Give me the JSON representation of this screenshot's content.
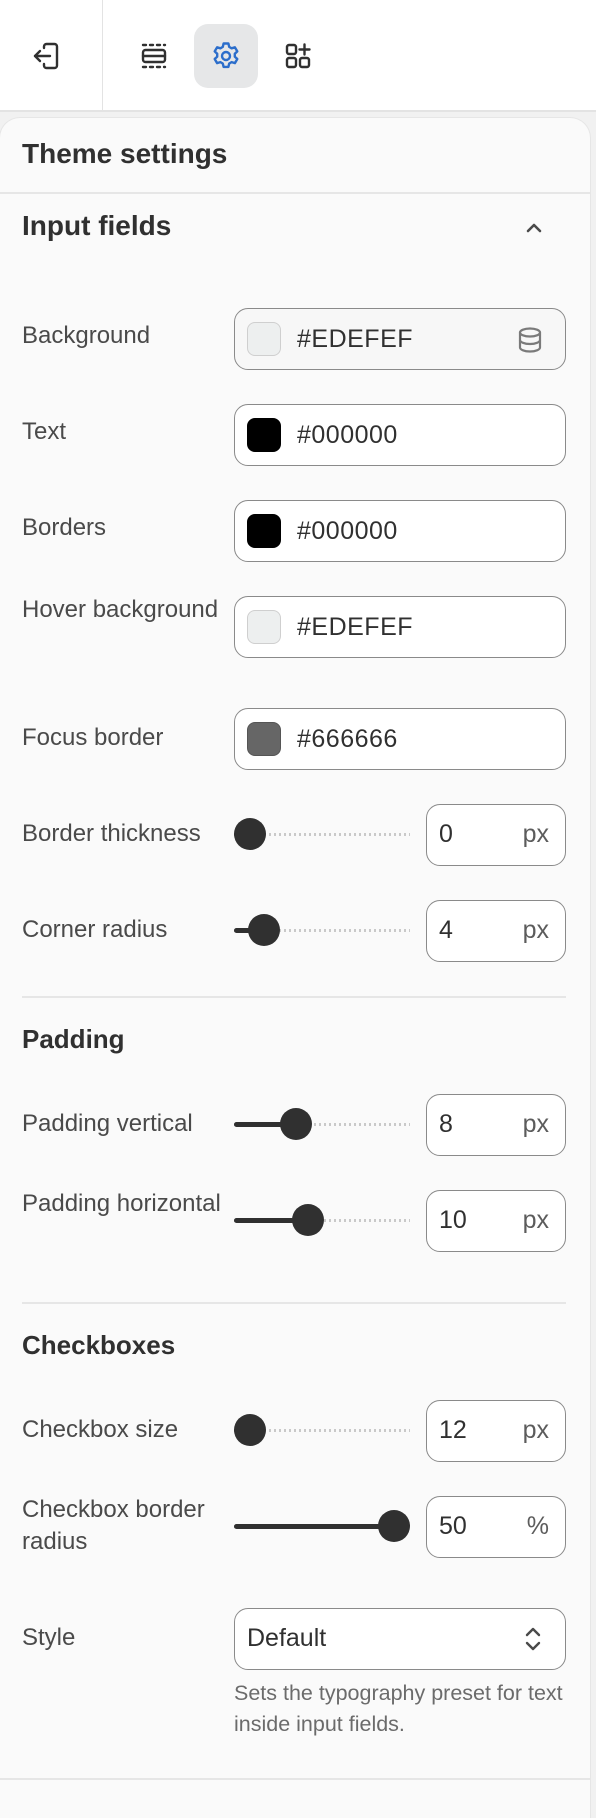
{
  "toolbar": {
    "buttons": [
      {
        "icon": "exit-icon",
        "active": false
      },
      {
        "icon": "sections-icon",
        "active": false
      },
      {
        "icon": "settings-gear-icon",
        "active": true
      },
      {
        "icon": "apps-add-icon",
        "active": false
      }
    ],
    "active_color": "#2c6ecb"
  },
  "panel": {
    "title": "Theme settings"
  },
  "input_fields": {
    "heading": "Input fields",
    "expanded": true,
    "colors": [
      {
        "label": "Background",
        "value": "#EDEFEF",
        "swatch": "#EDEFEF",
        "linked": true
      },
      {
        "label": "Text",
        "value": "#000000",
        "swatch": "#000000",
        "linked": false
      },
      {
        "label": "Borders",
        "value": "#000000",
        "swatch": "#000000",
        "linked": false
      },
      {
        "label": "Hover background",
        "value": "#EDEFEF",
        "swatch": "#EDEFEF",
        "linked": false
      },
      {
        "label": "Focus border",
        "value": "#666666",
        "swatch": "#666666",
        "linked": false
      }
    ],
    "border_thickness": {
      "label": "Border thickness",
      "value": "0",
      "unit": "px",
      "fraction": 0.0
    },
    "corner_radius": {
      "label": "Corner radius",
      "value": "4",
      "unit": "px",
      "fraction": 0.1
    }
  },
  "padding": {
    "heading": "Padding",
    "vertical": {
      "label": "Padding vertical",
      "value": "8",
      "unit": "px",
      "fraction": 0.32
    },
    "horizontal": {
      "label": "Padding horizontal",
      "value": "10",
      "unit": "px",
      "fraction": 0.4
    }
  },
  "checkboxes": {
    "heading": "Checkboxes",
    "size": {
      "label": "Checkbox size",
      "value": "12",
      "unit": "px",
      "fraction": 0.0
    },
    "border_radius": {
      "label": "Checkbox border radius",
      "value": "50",
      "unit": "%",
      "fraction": 1.0
    },
    "style": {
      "label": "Style",
      "value": "Default",
      "help": "Sets the typography preset for text inside input fields."
    }
  }
}
